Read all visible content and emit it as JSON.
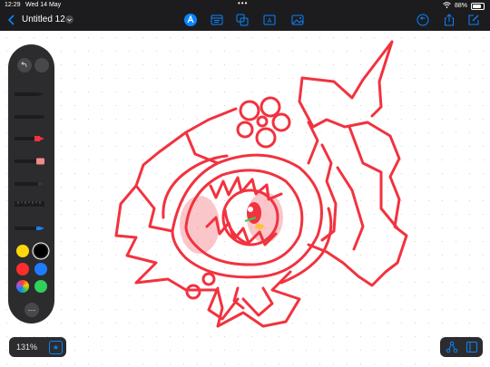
{
  "status": {
    "time": "12:29",
    "date": "Wed 14 May",
    "battery": "88%"
  },
  "document": {
    "title": "Untitled 12"
  },
  "toolbar": {
    "icons": [
      "back-chevron-icon",
      "title-chevron-icon",
      "pencil-tool-icon",
      "browser-icon",
      "shapes-icon",
      "text-box-icon",
      "photo-icon",
      "undo-history-icon",
      "share-icon",
      "compose-icon"
    ]
  },
  "palette": {
    "tools": [
      "pen",
      "marker",
      "brush",
      "eraser",
      "lasso",
      "ruler",
      "pencil"
    ],
    "swatches": [
      "#ffd60a",
      "#000000",
      "#ff2d2d",
      "#1e7bff",
      "#rainbow",
      "#2fd158"
    ],
    "more_label": "…"
  },
  "zoom": {
    "level": "131%"
  },
  "colors": {
    "accent": "#0a84ff",
    "ink": "#f2323f"
  }
}
